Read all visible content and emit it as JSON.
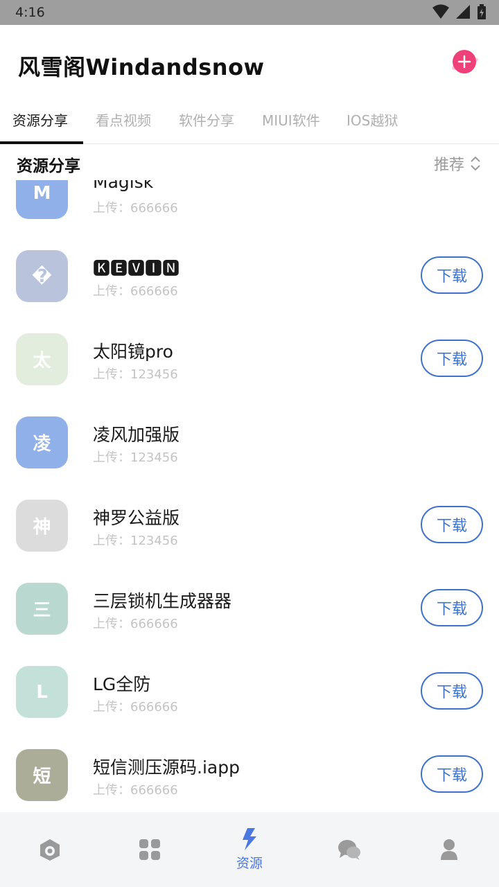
{
  "status": {
    "time": "4:16"
  },
  "header": {
    "title": "风雪阁Windandsnow"
  },
  "tabs": [
    {
      "label": "资源分享",
      "active": true
    },
    {
      "label": "看点视频",
      "active": false
    },
    {
      "label": "软件分享",
      "active": false
    },
    {
      "label": "MIUI软件",
      "active": false
    },
    {
      "label": "IOS越狱",
      "active": false
    }
  ],
  "section": {
    "title": "资源分享",
    "sort_label": "推荐"
  },
  "items": [
    {
      "initial": "M",
      "title": "Magisk",
      "uploader": "上传：666666",
      "color": "#8fb0e8",
      "download": ""
    },
    {
      "initial": "�",
      "title": "🅺🅴🆅🅸🅽",
      "uploader": "上传：666666",
      "color": "#b9c3dc",
      "download": "下载"
    },
    {
      "initial": "太",
      "title": "太阳镜pro",
      "uploader": "上传：123456",
      "color": "#e3edde",
      "download": "下载"
    },
    {
      "initial": "凌",
      "title": "凌风加强版",
      "uploader": "上传：123456",
      "color": "#8fb0e8",
      "download": ""
    },
    {
      "initial": "神",
      "title": "神罗公益版",
      "uploader": "上传：123456",
      "color": "#dcdcdc",
      "download": "下载"
    },
    {
      "initial": "三",
      "title": "三层锁机生成器器",
      "uploader": "上传：666666",
      "color": "#b9d8cf",
      "download": "下载"
    },
    {
      "initial": "L",
      "title": "LG全防",
      "uploader": "上传：666666",
      "color": "#c3e1d9",
      "download": "下载"
    },
    {
      "initial": "短",
      "title": "短信测压源码.iapp",
      "uploader": "上传：666666",
      "color": "#abad99",
      "download": "下载"
    }
  ],
  "bottom_nav": [
    {
      "icon": "home-icon",
      "label": ""
    },
    {
      "icon": "apps-icon",
      "label": ""
    },
    {
      "icon": "lightning-icon",
      "label": "资源",
      "active": true
    },
    {
      "icon": "chat-icon",
      "label": ""
    },
    {
      "icon": "profile-icon",
      "label": ""
    }
  ],
  "colors": {
    "accent": "#3e72c9",
    "nav_active": "#4a78e0",
    "add_button": "#f0407a"
  }
}
